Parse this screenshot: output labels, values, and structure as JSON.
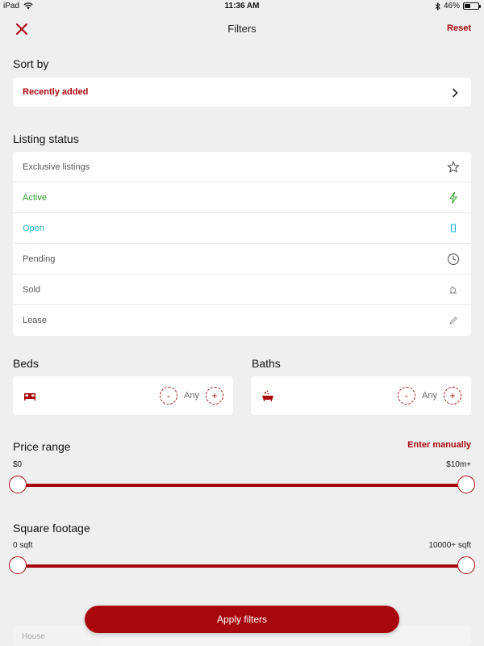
{
  "status_bar": {
    "device": "iPad",
    "time": "11:36 AM",
    "battery": "46%",
    "battery_level": 0.46
  },
  "nav": {
    "title": "Filters",
    "reset_label": "Reset",
    "close_icon": "close-icon"
  },
  "sort": {
    "section_title": "Sort by",
    "value": "Recently added"
  },
  "listing_status": {
    "section_title": "Listing status",
    "items": [
      {
        "label": "Exclusive listings",
        "color": "#555555",
        "icon": "star-icon"
      },
      {
        "label": "Active",
        "color": "#2aa02a",
        "icon": "lightning-icon"
      },
      {
        "label": "Open",
        "color": "#19b3d6",
        "icon": "door-icon"
      },
      {
        "label": "Pending",
        "color": "#555555",
        "icon": "clock-icon"
      },
      {
        "label": "Sold",
        "color": "#555555",
        "icon": "hand-icon"
      },
      {
        "label": "Lease",
        "color": "#555555",
        "icon": "pen-icon"
      }
    ]
  },
  "beds": {
    "section_title": "Beds",
    "value": "Any",
    "minus": "-",
    "plus": "+"
  },
  "baths": {
    "section_title": "Baths",
    "value": "Any",
    "minus": "-",
    "plus": "+"
  },
  "price_range": {
    "section_title": "Price range",
    "enter_manually": "Enter manually",
    "min_label": "$0",
    "max_label": "$10m+",
    "min_fraction": 0,
    "max_fraction": 1
  },
  "square_footage": {
    "section_title": "Square footage",
    "min_label": "0 sqft",
    "max_label": "10000+ sqft",
    "min_fraction": 0,
    "max_fraction": 1
  },
  "apply_label": "Apply filters",
  "behind_row_label": "House",
  "accent_color": "#a7070d"
}
